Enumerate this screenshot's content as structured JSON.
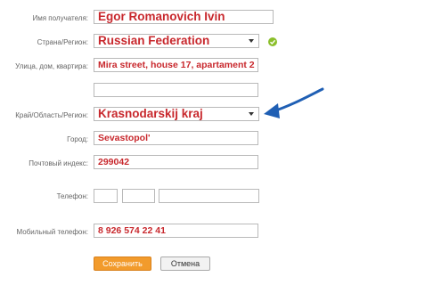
{
  "form": {
    "recipient": {
      "label": "Имя получателя:",
      "value": "Egor Romanovich Ivin"
    },
    "country": {
      "label": "Страна/Регион:",
      "value": "Russian Federation",
      "status_icon": "check-circle-icon",
      "status_color": "#8bbf2b"
    },
    "street": {
      "label": "Улица, дом, квартира:",
      "value": "Mira street, house 17, apartament 2"
    },
    "street2": {
      "value": ""
    },
    "region": {
      "label": "Край/Область/Регион:",
      "value": "Krasnodarskij kraj"
    },
    "city": {
      "label": "Город:",
      "value": "Sevastopol'"
    },
    "zip": {
      "label": "Почтовый индекс:",
      "value": "299042"
    },
    "phone": {
      "label": "Телефон:",
      "country_code": "",
      "area_code": "",
      "number": ""
    },
    "mobile": {
      "label": "Мобильный телефон:",
      "value": "8 926 574 22 41"
    }
  },
  "actions": {
    "save_label": "Сохранить",
    "cancel_label": "Отмена"
  },
  "annotation": {
    "icon": "arrow-icon",
    "color": "#1f5fb4"
  },
  "colors": {
    "field_text": "#c8282d",
    "save_button": "#f29b2c"
  }
}
